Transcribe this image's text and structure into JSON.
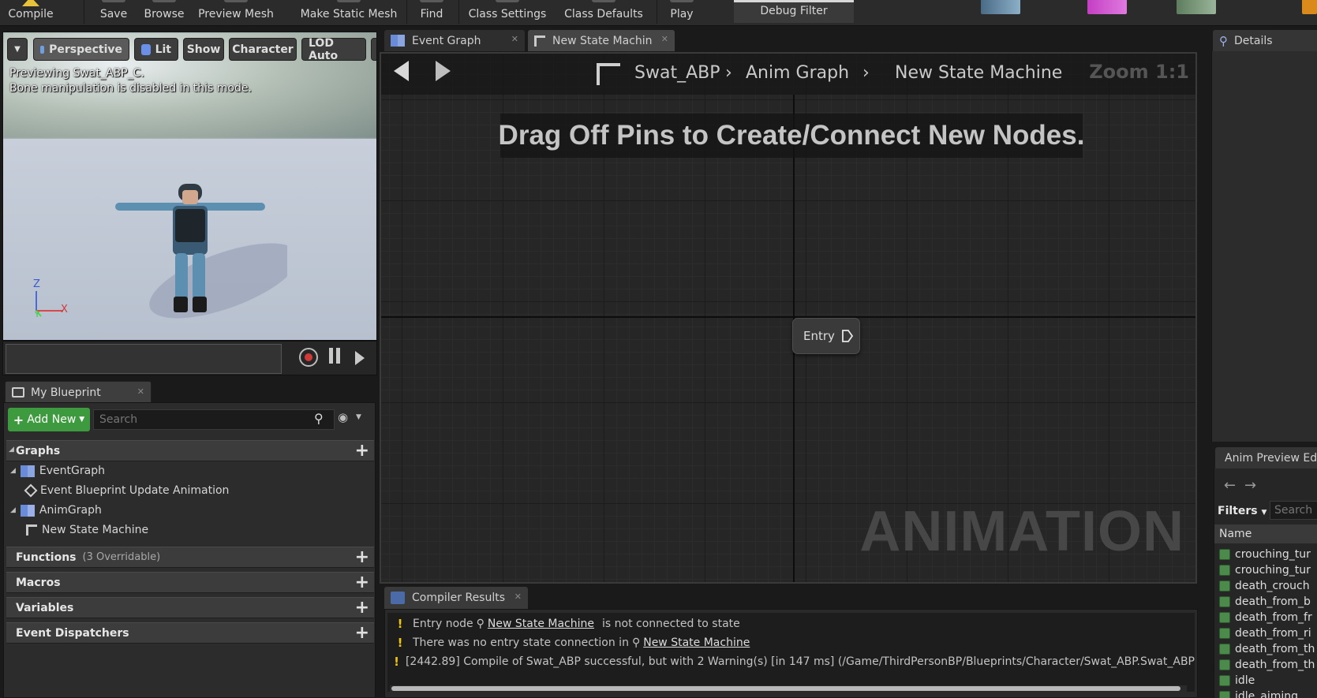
{
  "toolbar": {
    "compile": "Compile",
    "save": "Save",
    "browse": "Browse",
    "preview_mesh": "Preview Mesh",
    "make_static_mesh": "Make Static Mesh",
    "find": "Find",
    "class_settings": "Class Settings",
    "class_defaults": "Class Defaults",
    "play": "Play",
    "debug_filter": "Debug Filter"
  },
  "viewport": {
    "perspective": "Perspective",
    "lit": "Lit",
    "show": "Show",
    "character": "Character",
    "lod": "LOD Auto",
    "message_1": "Previewing Swat_ABP_C.",
    "message_2": "Bone manipulation is disabled in this mode.",
    "axis_z": "Z",
    "axis_x": "X",
    "axis_y": "Y"
  },
  "my_blueprint": {
    "tab_label": "My Blueprint",
    "add_new": "Add New",
    "search_placeholder": "Search",
    "graphs_label": "Graphs",
    "event_graph": "EventGraph",
    "event_update": "Event Blueprint Update Animation",
    "anim_graph": "AnimGraph",
    "new_state_machine": "New State Machine",
    "functions_label": "Functions",
    "functions_count": "(3 Overridable)",
    "macros_label": "Macros",
    "variables_label": "Variables",
    "dispatchers_label": "Event Dispatchers"
  },
  "graph_tabs": {
    "event_graph": "Event Graph",
    "state_machine": "New State Machin"
  },
  "graph": {
    "crumb_1": "Swat_ABP",
    "crumb_2": "Anim Graph",
    "crumb_3": "New State Machine",
    "zoom": "Zoom 1:1",
    "hint": "Drag Off Pins to Create/Connect New Nodes.",
    "entry_label": "Entry",
    "watermark": "ANIMATION"
  },
  "compiler": {
    "tab_label": "Compiler Results",
    "line1_prefix": "Entry node",
    "line1_link": "New State Machine",
    "line1_suffix": "is not connected to state",
    "line2_prefix": "There was no entry state connection in",
    "line2_link": "New State Machine",
    "line3": "[2442.89] Compile of Swat_ABP successful, but with 2 Warning(s) [in 147 ms] (/Game/ThirdPersonBP/Blueprints/Character/Swat_ABP.Swat_ABP"
  },
  "details": {
    "tab_label": "Details"
  },
  "anim_preview": {
    "tab_label": "Anim Preview Ed",
    "filters": "Filters",
    "search_placeholder": "Search",
    "name_header": "Name",
    "items": [
      "crouching_tur",
      "crouching_tur",
      "death_crouch",
      "death_from_b",
      "death_from_fr",
      "death_from_ri",
      "death_from_th",
      "death_from_th",
      "idle",
      "idle_aiming"
    ]
  },
  "colors": {
    "accent_green": "#3e9a3e",
    "warning_yellow": "#f1c40f",
    "graph_background": "#262626"
  }
}
